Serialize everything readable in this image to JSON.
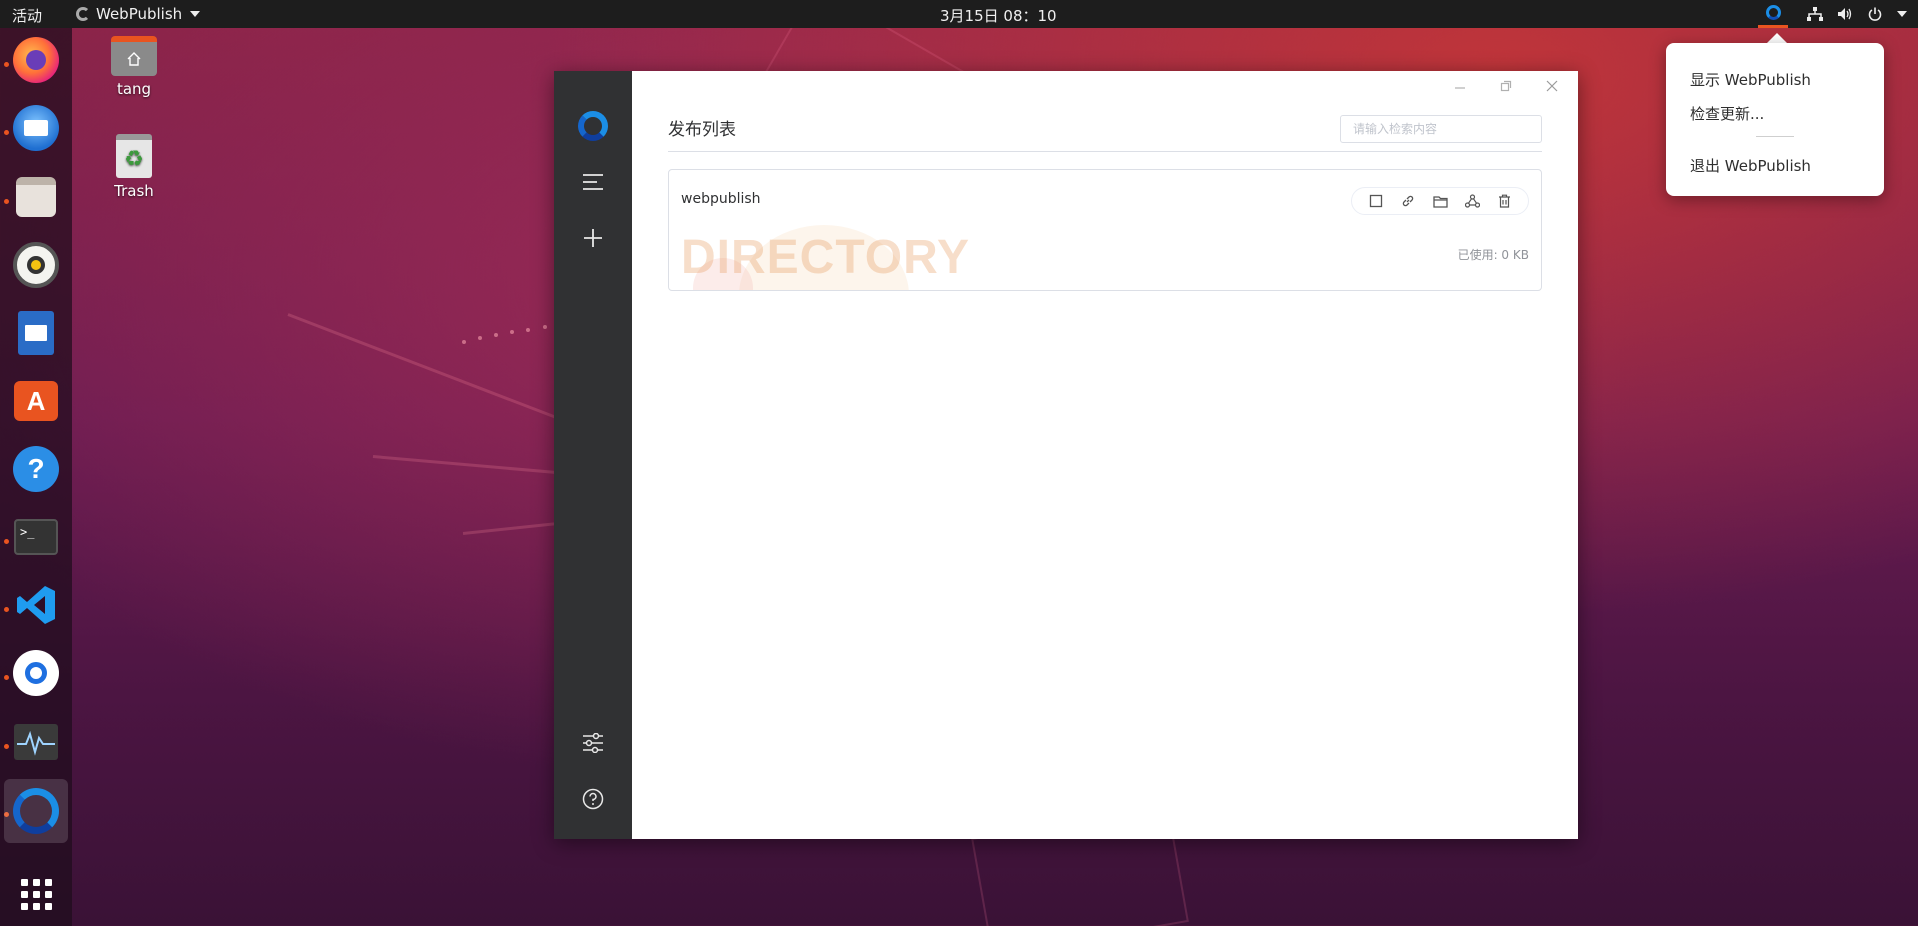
{
  "topbar": {
    "activities": "活动",
    "app_name": "WebPublish",
    "clock": "3月15日  08：10"
  },
  "dock": {
    "apps": [
      "firefox-icon",
      "thunderbird-icon",
      "files-icon",
      "rhythmbox-icon",
      "libreoffice-impress-icon",
      "software-center-icon",
      "help-icon",
      "terminal-icon",
      "vscode-icon",
      "qq-icon",
      "system-monitor-icon",
      "webpublish-icon",
      "show-applications-icon"
    ]
  },
  "desktop": {
    "home_label": "tang",
    "trash_label": "Trash"
  },
  "window": {
    "title": "发布列表",
    "search_placeholder": "请输入检索内容",
    "items": [
      {
        "name": "webpublish",
        "type_label": "DIRECTORY",
        "usage": "已使用: 0 KB"
      }
    ]
  },
  "tray_menu": {
    "show": "显示 WebPublish",
    "check_update": "检查更新...",
    "quit": "退出 WebPublish"
  },
  "colors": {
    "accent": "#e95420",
    "sidebar": "#303133",
    "brand_blue": "#1b8ee6"
  }
}
